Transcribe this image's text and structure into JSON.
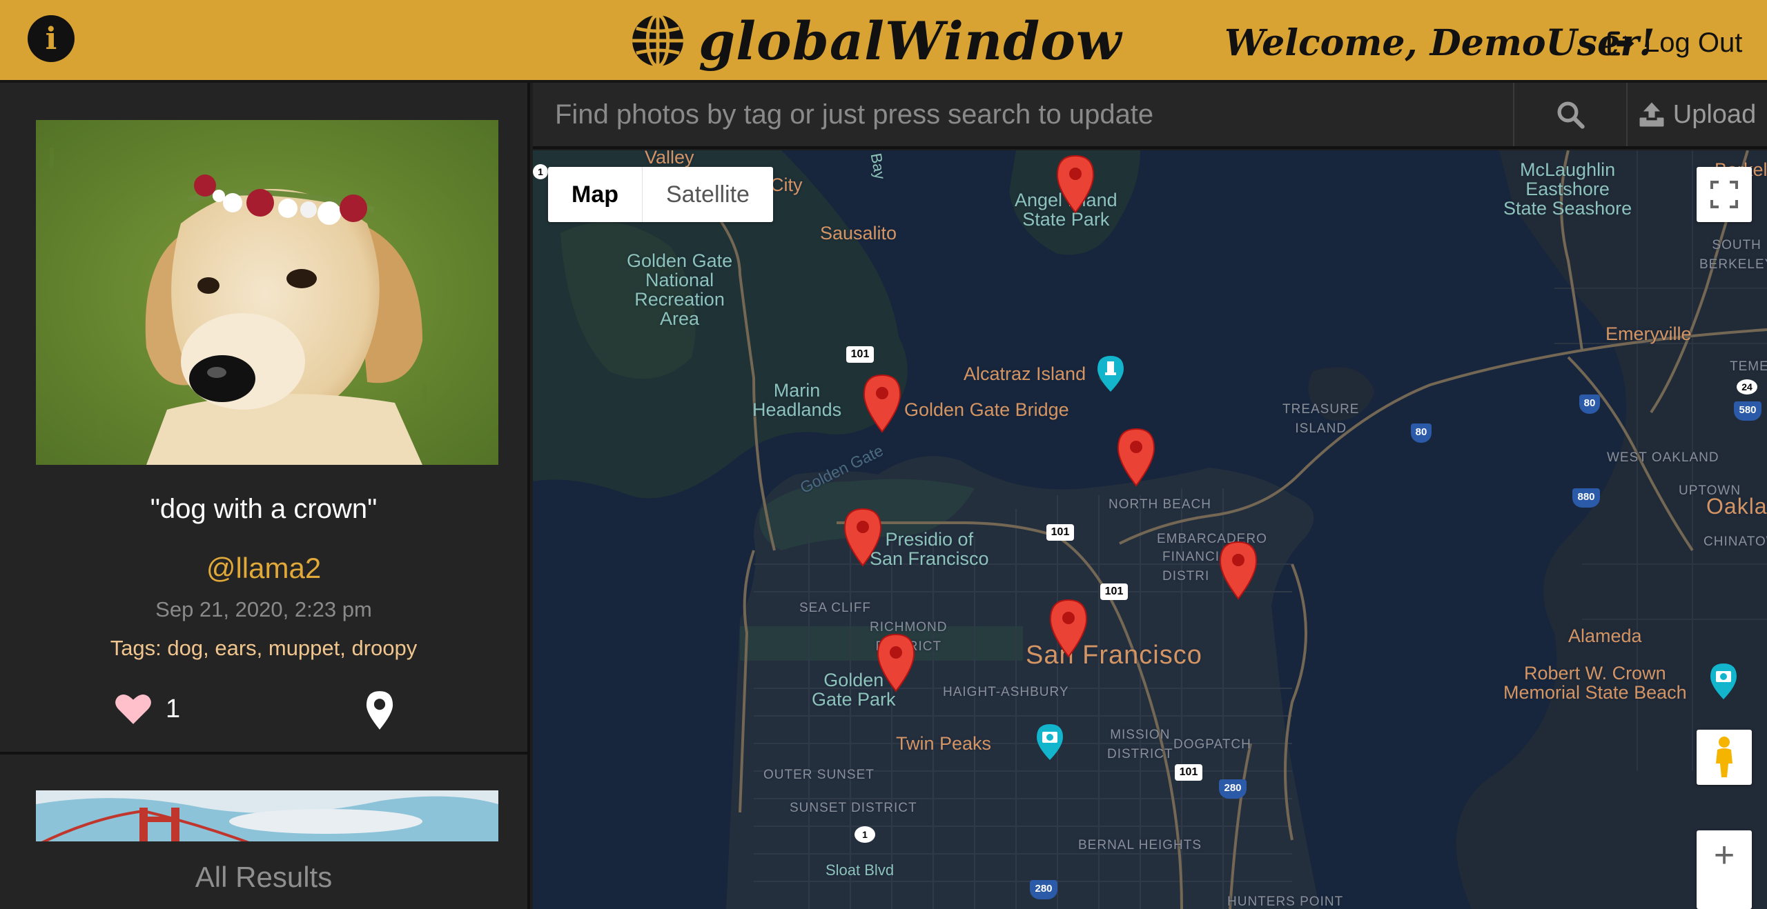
{
  "header": {
    "info_glyph": "i",
    "brand_title": "globalWindow",
    "welcome": "Welcome, DemoUser!",
    "logout_label": "Log Out"
  },
  "sidebar": {
    "card": {
      "caption": "\"dog with a crown\"",
      "username": "@llama2",
      "date": "Sep 21, 2020, 2:23 pm",
      "tags": "Tags: dog, ears, muppet, droopy",
      "likes": "1"
    },
    "all_results_label": "All Results"
  },
  "search": {
    "placeholder": "Find photos by tag or just press search to update",
    "upload_label": "Upload"
  },
  "map": {
    "type_buttons": {
      "map": "Map",
      "satellite": "Satellite"
    },
    "labels": {
      "valley": "Valley",
      "city": "City",
      "bay": "n Bay",
      "sausalito": "Sausalito",
      "angel_island": "Angel Island\nState Park",
      "ggnra": "Golden Gate\nNational\nRecreation\nArea",
      "mclaughlin": "McLaughlin\nEastshore\nState Seashore",
      "berkeley": "Berkel",
      "south_berkeley": "SOUTH\nBERKELEY",
      "emeryville": "Emeryville",
      "teme": "TEME",
      "alcatraz": "Alcatraz Island",
      "marin": "Marin\nHeadlands",
      "golden_gate_bridge": "Golden Gate Bridge",
      "treasure_island": "TREASURE\nISLAND",
      "golden_gate_water": "Golden Gate",
      "west_oakland": "WEST OAKLAND",
      "uptown": "UPTOWN",
      "oakland": "Oakland",
      "chinatown": "CHINATOW",
      "north_beach": "NORTH BEACH",
      "embarcadero": "EMBARCADERO",
      "financial": "FINANCI\nDISTRI",
      "presidio": "Presidio of\nSan Francisco",
      "sea_cliff": "SEA CLIFF",
      "richmond": "RICHMOND\nDISTRICT",
      "san_francisco": "San Francisco",
      "golden_gate_park": "Golden\nGate Park",
      "haight": "HAIGHT-ASHBURY",
      "alameda": "Alameda",
      "crown_beach": "Robert W. Crown\nMemorial State Beach",
      "twin_peaks": "Twin Peaks",
      "mission": "MISSION\nDISTRICT",
      "dogpatch": "DOGPATCH",
      "outer_sunset": "OUTER SUNSET",
      "sunset": "SUNSET DISTRICT",
      "bernal": "BERNAL HEIGHTS",
      "sloat": "Sloat Blvd",
      "hunters_point": "HUNTERS POINT"
    },
    "shields": {
      "hwy1_top": "1",
      "us101_a": "101",
      "us101_b": "101",
      "us101_c": "101",
      "us101_d": "101",
      "i80_a": "80",
      "i80_b": "80",
      "i580": "580",
      "ca24": "24",
      "i880": "880",
      "i280_a": "280",
      "i280_b": "280",
      "hwy1_bottom": "1"
    },
    "zoom_in_glyph": "+"
  },
  "colors": {
    "header_bg": "#d9a334",
    "accent_username": "#e0a93a",
    "tags_text": "#f0c58e",
    "map_water": "#17263c",
    "marker_red": "#ea4335",
    "heart_pink": "#ffc0cb"
  },
  "icons": [
    "info-icon",
    "globe-icon",
    "sign-out-icon",
    "search-icon",
    "upload-icon",
    "heart-icon",
    "map-pin-icon",
    "fullscreen-icon",
    "pegman-icon",
    "map-marker-icon",
    "lighthouse-poi-icon",
    "camera-poi-icon"
  ]
}
